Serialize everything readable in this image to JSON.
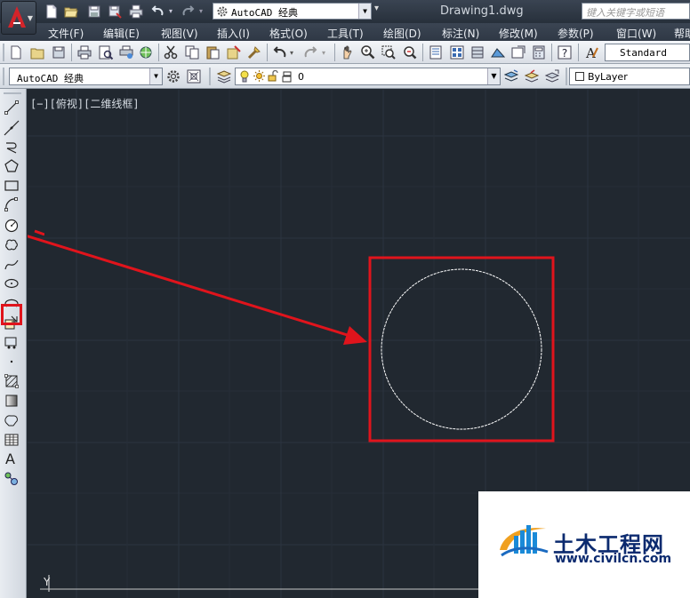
{
  "titlebar": {
    "workspace": "AutoCAD 经典",
    "document_title": "Drawing1.dwg",
    "search_placeholder": "键入关键字或短语"
  },
  "menu": {
    "items": [
      "文件(F)",
      "编辑(E)",
      "视图(V)",
      "插入(I)",
      "格式(O)",
      "工具(T)",
      "绘图(D)",
      "标注(N)",
      "修改(M)",
      "参数(P)",
      "窗口(W)",
      "帮助"
    ]
  },
  "toolbar1": {
    "text_style": "Standard"
  },
  "toolbar2": {
    "workspace": "AutoCAD 经典",
    "layer": "0",
    "color": "ByLayer"
  },
  "canvas": {
    "viewport_label": "[−][俯视][二维线框]",
    "ucs_label": "Y"
  },
  "colors": {
    "canvas_bg": "#212830",
    "highlight": "#e0141c",
    "circle": "#ffffff"
  },
  "watermark": {
    "name": "土木工程网",
    "url": "www.civilcn.com"
  }
}
